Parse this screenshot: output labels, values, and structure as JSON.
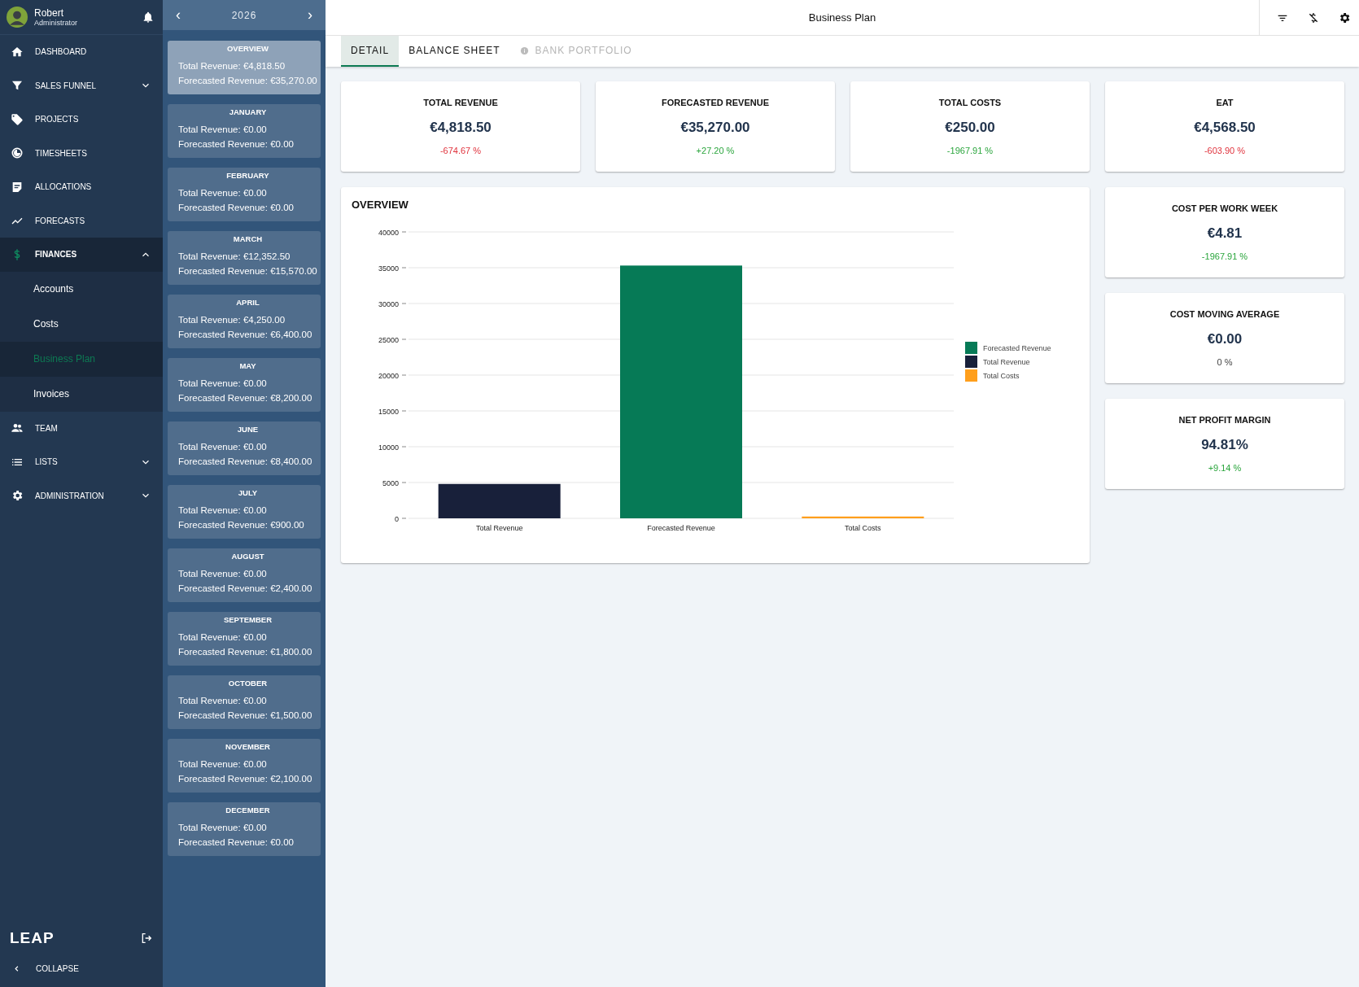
{
  "user": {
    "name": "Robert",
    "role": "Administrator"
  },
  "nav": [
    {
      "label": "DASHBOARD",
      "selected": false
    },
    {
      "label": "SALES FUNNEL",
      "expanded": false,
      "selected": false
    },
    {
      "label": "PROJECTS",
      "selected": false
    },
    {
      "label": "TIMESHEETS",
      "selected": false
    },
    {
      "label": "ALLOCATIONS",
      "selected": false
    },
    {
      "label": "FORECASTS",
      "selected": false
    },
    {
      "label": "FINANCES",
      "expanded": true,
      "selected": true,
      "children": [
        {
          "label": "Accounts",
          "selected": false
        },
        {
          "label": "Costs",
          "selected": false
        },
        {
          "label": "Business Plan",
          "selected": true
        },
        {
          "label": "Invoices",
          "selected": false
        }
      ]
    },
    {
      "label": "TEAM",
      "selected": false
    },
    {
      "label": "LISTS",
      "expanded": false,
      "selected": false
    },
    {
      "label": "ADMINISTRATION",
      "expanded": false,
      "selected": false
    }
  ],
  "logo": "LEAP",
  "collapse": "COLLAPSE",
  "year": {
    "prev": "‹",
    "label": "2026",
    "next": "›"
  },
  "months": [
    {
      "title": "OVERVIEW",
      "total": "Total Revenue: €4,818.50",
      "forecast": "Forecasted Revenue: €35,270.00",
      "selected": true
    },
    {
      "title": "JANUARY",
      "total": "Total Revenue: €0.00",
      "forecast": "Forecasted Revenue: €0.00",
      "selected": false
    },
    {
      "title": "FEBRUARY",
      "total": "Total Revenue: €0.00",
      "forecast": "Forecasted Revenue: €0.00",
      "selected": false
    },
    {
      "title": "MARCH",
      "total": "Total Revenue: €12,352.50",
      "forecast": "Forecasted Revenue: €15,570.00",
      "selected": false
    },
    {
      "title": "APRIL",
      "total": "Total Revenue: €4,250.00",
      "forecast": "Forecasted Revenue: €6,400.00",
      "selected": false
    },
    {
      "title": "MAY",
      "total": "Total Revenue: €0.00",
      "forecast": "Forecasted Revenue: €8,200.00",
      "selected": false
    },
    {
      "title": "JUNE",
      "total": "Total Revenue: €0.00",
      "forecast": "Forecasted Revenue: €8,400.00",
      "selected": false
    },
    {
      "title": "JULY",
      "total": "Total Revenue: €0.00",
      "forecast": "Forecasted Revenue: €900.00",
      "selected": false
    },
    {
      "title": "AUGUST",
      "total": "Total Revenue: €0.00",
      "forecast": "Forecasted Revenue: €2,400.00",
      "selected": false
    },
    {
      "title": "SEPTEMBER",
      "total": "Total Revenue: €0.00",
      "forecast": "Forecasted Revenue: €1,800.00",
      "selected": false
    },
    {
      "title": "OCTOBER",
      "total": "Total Revenue: €0.00",
      "forecast": "Forecasted Revenue: €1,500.00",
      "selected": false
    },
    {
      "title": "NOVEMBER",
      "total": "Total Revenue: €0.00",
      "forecast": "Forecasted Revenue: €2,100.00",
      "selected": false
    },
    {
      "title": "DECEMBER",
      "total": "Total Revenue: €0.00",
      "forecast": "Forecasted Revenue: €0.00",
      "selected": false
    }
  ],
  "header": {
    "title": "Business Plan"
  },
  "tabs": [
    {
      "label": "DETAIL",
      "selected": true,
      "disabled": false
    },
    {
      "label": "BALANCE SHEET",
      "selected": false,
      "disabled": false
    },
    {
      "label": "BANK PORTFOLIO",
      "selected": false,
      "disabled": true
    }
  ],
  "kpis": [
    {
      "title": "TOTAL REVENUE",
      "value": "€4,818.50",
      "change": "-674.67 %",
      "color": "#e0333d"
    },
    {
      "title": "FORECASTED REVENUE",
      "value": "€35,270.00",
      "change": "+27.20 %",
      "color": "#2aa53c"
    },
    {
      "title": "TOTAL COSTS",
      "value": "€250.00",
      "change": "-1967.91 %",
      "color": "#2aa53c"
    },
    {
      "title": "EAT",
      "value": "€4,568.50",
      "change": "-603.90 %",
      "color": "#e0333d"
    }
  ],
  "side_kpis": [
    {
      "title": "COST PER WORK WEEK",
      "value": "€4.81",
      "change": "-1967.91 %",
      "color": "#2aa53c"
    },
    {
      "title": "COST MOVING AVERAGE",
      "value": "€0.00",
      "change": "0 %",
      "color": "#444444"
    },
    {
      "title": "NET PROFIT MARGIN",
      "value": "94.81%",
      "change": "+9.14 %",
      "color": "#2aa53c"
    }
  ],
  "overview": {
    "title": "OVERVIEW",
    "chart_data": {
      "type": "bar",
      "categories": [
        "Total Revenue",
        "Forecasted Revenue",
        "Total Costs"
      ],
      "grid": true,
      "legend": true,
      "ylim": [
        0,
        40000
      ],
      "yticks": [
        0,
        5000,
        10000,
        15000,
        20000,
        25000,
        30000,
        35000,
        40000
      ],
      "series": [
        {
          "name": "Forecasted Revenue",
          "color": "#067a56",
          "values": [
            null,
            35300,
            null
          ]
        },
        {
          "name": "Total Revenue",
          "color": "#18203a",
          "values": [
            4800,
            null,
            null
          ]
        },
        {
          "name": "Total Costs",
          "color": "#ff9f1c",
          "values": [
            null,
            null,
            250
          ]
        }
      ]
    }
  }
}
